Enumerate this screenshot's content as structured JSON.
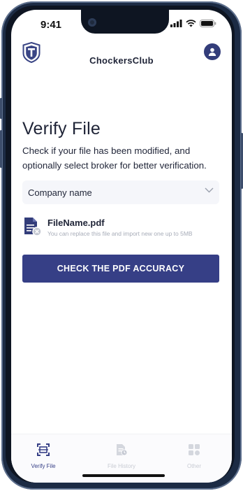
{
  "status_bar": {
    "time": "9:41"
  },
  "header": {
    "app_title": "ChockersClub"
  },
  "main": {
    "title": "Verify File",
    "description": "Check if your file has been modified, and optionally select broker for better verification.",
    "company_select": {
      "placeholder": "Company name"
    },
    "file": {
      "name": "FileName.pdf",
      "note": "You can replace this file and import new one up to 5MB"
    },
    "check_button_label": "CHECK THE PDF ACCURACY"
  },
  "tabs": [
    {
      "label": "Verify File",
      "icon": "scan-icon",
      "active": true
    },
    {
      "label": "File History",
      "icon": "file-history-icon",
      "active": false
    },
    {
      "label": "Other",
      "icon": "grid-icon",
      "active": false
    }
  ],
  "colors": {
    "primary": "#363f86",
    "text": "#1f2437",
    "muted": "#a7acb8",
    "frame": "#1c2b44"
  }
}
